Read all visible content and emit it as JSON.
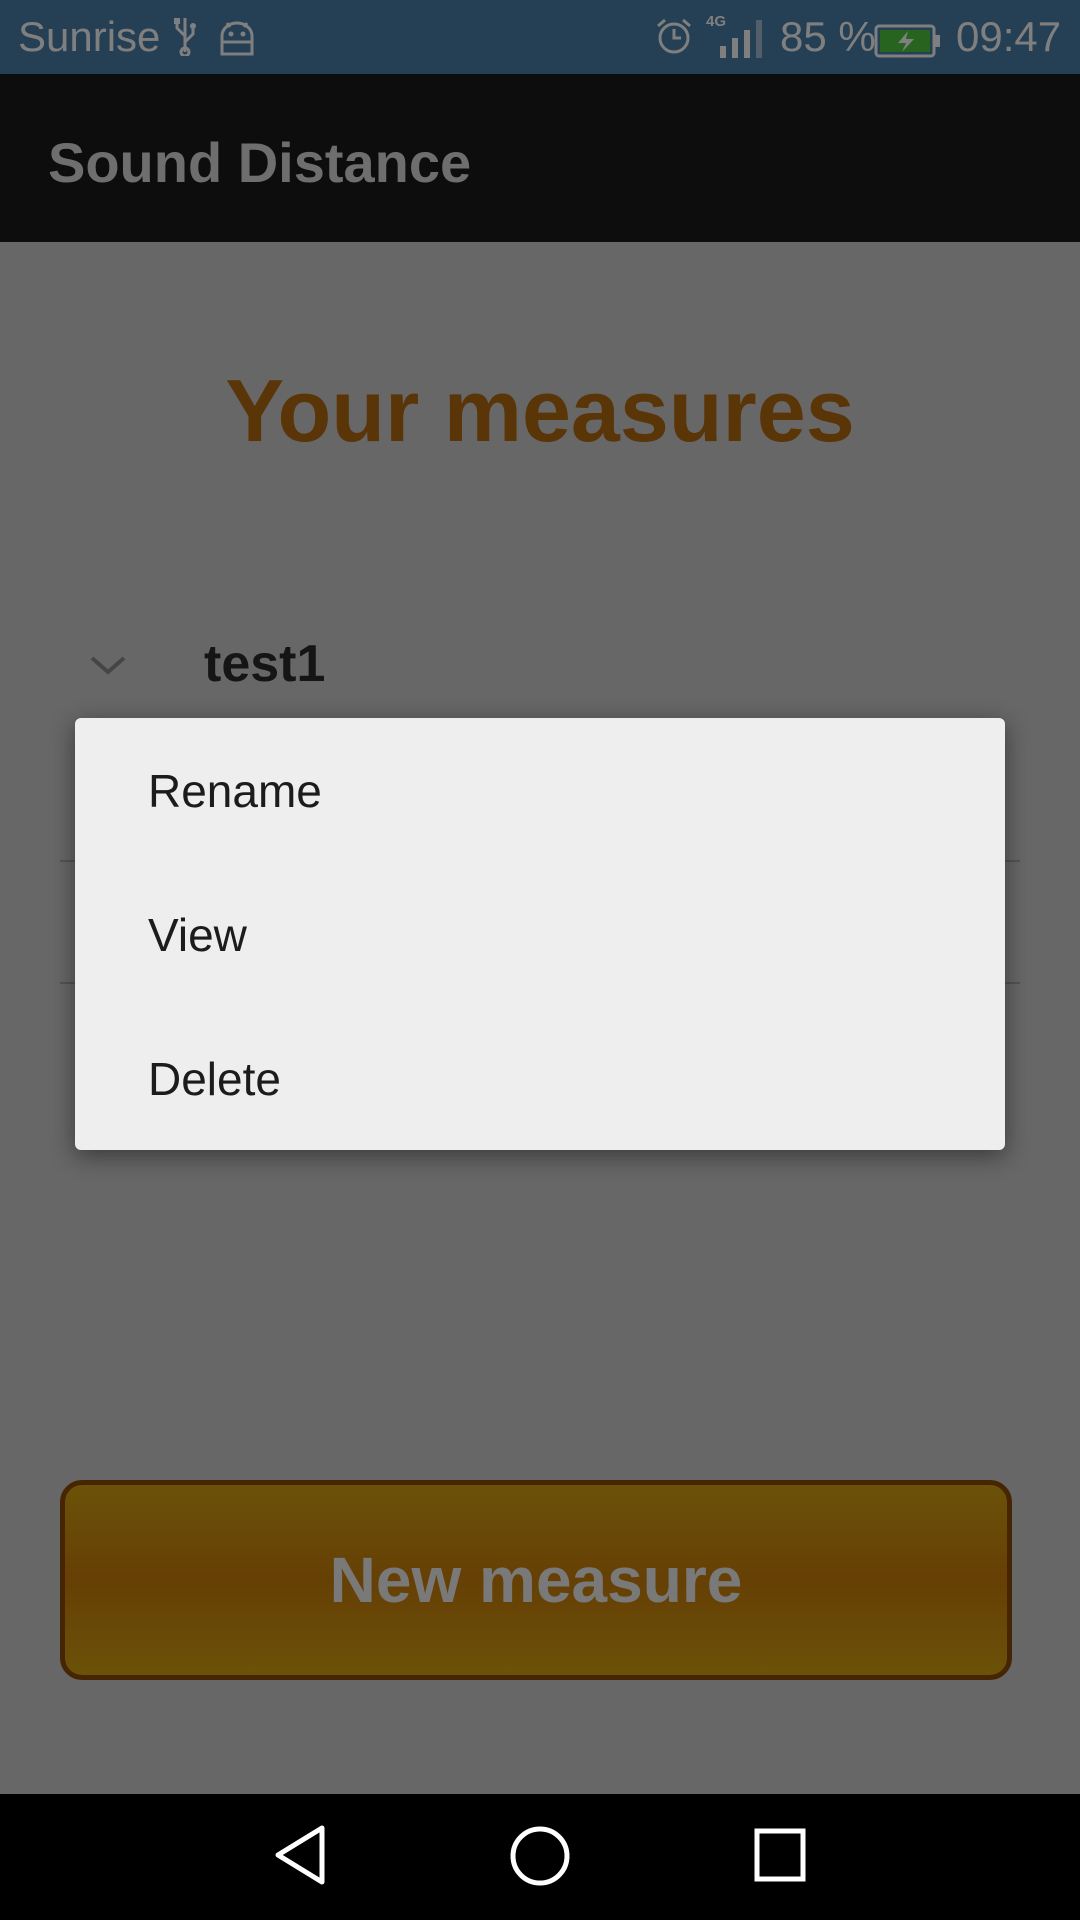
{
  "status_bar": {
    "carrier": "Sunrise",
    "network": "4G",
    "battery": "85 %",
    "time": "09:47",
    "icons": [
      "usb-icon",
      "android-icon",
      "alarm-icon",
      "signal-icon",
      "battery-icon"
    ]
  },
  "app_bar": {
    "title": "Sound Distance"
  },
  "main": {
    "heading": "Your measures",
    "items": [
      {
        "label": "test1"
      }
    ],
    "new_measure_label": "New measure"
  },
  "context_menu": {
    "items": [
      {
        "label": "Rename"
      },
      {
        "label": "View"
      },
      {
        "label": "Delete"
      }
    ]
  },
  "colors": {
    "accent": "#b36b10",
    "button_fill": "#cc800b",
    "status_bar": "#4a7fa8"
  },
  "nav_bar": {
    "icons": [
      "back-icon",
      "home-icon",
      "recents-icon"
    ]
  }
}
